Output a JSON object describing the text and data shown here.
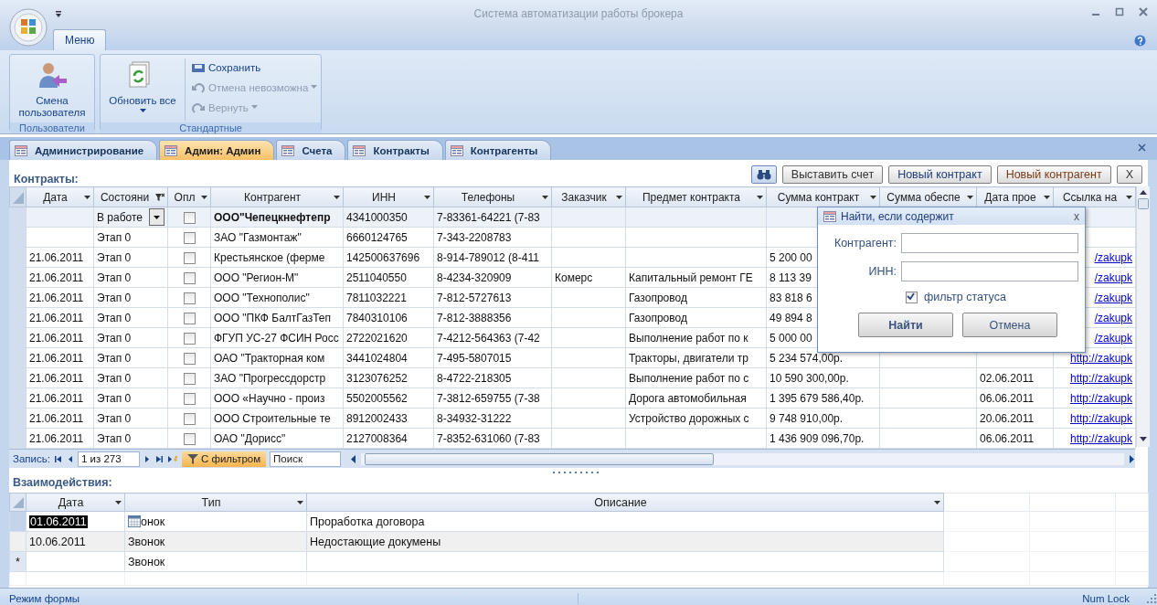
{
  "window": {
    "title": "Система автоматизации работы брокера"
  },
  "ribbon": {
    "tabs": [
      {
        "label": "Меню",
        "selected": true
      }
    ],
    "groups": [
      {
        "label": "Пользователи",
        "large_buttons": [
          {
            "label": "Смена пользователя",
            "dropdown": false
          }
        ]
      },
      {
        "label": "Стандартные",
        "large_buttons": [
          {
            "label": "Обновить все",
            "dropdown": true
          }
        ],
        "small_buttons": [
          {
            "label": "Сохранить",
            "disabled": false,
            "dropdown": false
          },
          {
            "label": "Отмена невозможна",
            "disabled": true,
            "dropdown": true
          },
          {
            "label": "Вернуть",
            "disabled": true,
            "dropdown": true
          }
        ]
      }
    ]
  },
  "doc_tabs": [
    {
      "label": "Администрирование",
      "selected": false
    },
    {
      "label": "Админ: Админ",
      "selected": true
    },
    {
      "label": "Счета",
      "selected": false
    },
    {
      "label": "Контракты",
      "selected": false
    },
    {
      "label": "Контрагенты",
      "selected": false
    }
  ],
  "form": {
    "title": "Контракты:",
    "buttons": [
      {
        "label": "Выставить счет",
        "kind": "normal"
      },
      {
        "label": "Новый контракт",
        "kind": "primary"
      },
      {
        "label": "Новый контрагент",
        "kind": "accent"
      },
      {
        "label": "X",
        "kind": "normal"
      }
    ]
  },
  "table": {
    "columns": [
      {
        "label": "Дата",
        "filtered": false
      },
      {
        "label": "Состояни",
        "filtered": true
      },
      {
        "label": "Опл",
        "filtered": false
      },
      {
        "label": "Контрагент",
        "filtered": false
      },
      {
        "label": "ИНН",
        "filtered": false
      },
      {
        "label": "Телефоны",
        "filtered": false
      },
      {
        "label": "Заказчик",
        "filtered": false
      },
      {
        "label": "Предмет контракта",
        "filtered": false
      },
      {
        "label": "Сумма контракт",
        "filtered": false
      },
      {
        "label": "Сумма обеспе",
        "filtered": false
      },
      {
        "label": "Дата прое",
        "filtered": false
      },
      {
        "label": "Ссылка на",
        "filtered": false
      }
    ],
    "rows": [
      {
        "selected": true,
        "date": "",
        "status": "В работе",
        "paid": false,
        "contractor": "ООО\"Чепецкнефтепр",
        "inn": "4341000350",
        "phones": "7-83361-64221  (7-83",
        "customer": "",
        "subject": "",
        "sum": "",
        "deposit": "",
        "deadline": "",
        "link": ""
      },
      {
        "selected": false,
        "date": "",
        "status": "Этап 0",
        "paid": false,
        "contractor": "ЗАО \"Газмонтаж\"",
        "inn": "6660124765",
        "phones": "7-343-2208783",
        "customer": "",
        "subject": "",
        "sum": "",
        "deposit": "",
        "deadline": "",
        "link": ""
      },
      {
        "selected": false,
        "date": "21.06.2011",
        "status": "Этап 0",
        "paid": false,
        "contractor": "Крестьянское (ферме",
        "inn": "142500637696",
        "phones": "8-914-789012  (8-411",
        "customer": "",
        "subject": "",
        "sum": "5 200 00",
        "deposit": "",
        "deadline": "",
        "link": "/zakupk"
      },
      {
        "selected": false,
        "date": "21.06.2011",
        "status": "Этап 0",
        "paid": false,
        "contractor": "ООО \"Регион-М\"",
        "inn": "2511040550",
        "phones": "8-4234-320909",
        "customer": "Комерс",
        "subject": "Капитальный ремонт ГЕ",
        "sum": "8 113 39",
        "deposit": "",
        "deadline": "",
        "link": "/zakupk"
      },
      {
        "selected": false,
        "date": "21.06.2011",
        "status": "Этап 0",
        "paid": false,
        "contractor": "ООО \"Технополис\"",
        "inn": "7811032221",
        "phones": "7-812-5727613",
        "customer": "",
        "subject": "Газопровод",
        "sum": "83 818 6",
        "deposit": "",
        "deadline": "",
        "link": "/zakupk"
      },
      {
        "selected": false,
        "date": "21.06.2011",
        "status": "Этап 0",
        "paid": false,
        "contractor": "ООО \"ПКФ БалтГазТеп",
        "inn": "7840310106",
        "phones": "7-812-3888356",
        "customer": "",
        "subject": "Газопровод",
        "sum": "49 894 8",
        "deposit": "",
        "deadline": "",
        "link": "/zakupk"
      },
      {
        "selected": false,
        "date": "21.06.2011",
        "status": "Этап 0",
        "paid": false,
        "contractor": "ФГУП УС-27 ФСИН Росс",
        "inn": "2722021620",
        "phones": "7-4212-564363  (7-42",
        "customer": "",
        "subject": "Выполнение работ по к",
        "sum": "5 000 00",
        "deposit": "",
        "deadline": "",
        "link": "/zakupk"
      },
      {
        "selected": false,
        "date": "21.06.2011",
        "status": "Этап 0",
        "paid": false,
        "contractor": "ОАО \"Тракторная ком",
        "inn": "3441024804",
        "phones": "7-495-5807015",
        "customer": "",
        "subject": "Тракторы, двигатели тр",
        "sum": "5 234 574,00р.",
        "deposit": "",
        "deadline": "",
        "link": "http://zakupk"
      },
      {
        "selected": false,
        "date": "21.06.2011",
        "status": "Этап 0",
        "paid": false,
        "contractor": "ЗАО \"Прогрессдорстр",
        "inn": "3123076252",
        "phones": "8-4722-218305",
        "customer": "",
        "subject": "Выполнение работ по с",
        "sum": "10 590 300,00р.",
        "deposit": "",
        "deadline": "02.06.2011",
        "link": "http://zakupk"
      },
      {
        "selected": false,
        "date": "21.06.2011",
        "status": "Этап 0",
        "paid": false,
        "contractor": "ООО  «Научно - произ",
        "inn": "5502005562",
        "phones": "7-3812-659755  (7-38",
        "customer": "",
        "subject": "Дорога автомобильная",
        "sum": "1 395 679 586,40р.",
        "deposit": "",
        "deadline": "06.06.2011",
        "link": "http://zakupk"
      },
      {
        "selected": false,
        "date": "21.06.2011",
        "status": "Этап 0",
        "paid": false,
        "contractor": "ООО Строительные те",
        "inn": "8912002433",
        "phones": "8-34932-31222",
        "customer": "",
        "subject": "Устройство дорожных с",
        "sum": "9 748 910,00р.",
        "deposit": "",
        "deadline": "20.06.2011",
        "link": "http://zakupk"
      },
      {
        "selected": false,
        "date": "21.06.2011",
        "status": "Этап 0",
        "paid": false,
        "contractor": "ОАО \"Дорисс\"",
        "inn": "2127008364",
        "phones": "7-8352-631060  (7-83",
        "customer": "",
        "subject": "",
        "sum": "1 436 909 096,70р.",
        "deposit": "",
        "deadline": "06.06.2011",
        "link": "http://zakupk"
      }
    ]
  },
  "navigation": {
    "label": "Запись:",
    "position": "1 из 273",
    "filter_label": "С фильтром",
    "filter_on": true,
    "search_placeholder": "Поиск"
  },
  "dialog": {
    "title": "Найти, если содержит",
    "close": "x",
    "fields": [
      {
        "label": "Контрагент:"
      },
      {
        "label": "ИНН:"
      }
    ],
    "filter_label": "фильтр статуса",
    "filter_checked": true,
    "buttons": [
      {
        "label": "Найти",
        "default": true
      },
      {
        "label": "Отмена",
        "default": false
      }
    ]
  },
  "subform": {
    "title": "Взаимодействия:",
    "columns": [
      "Дата",
      "Тип",
      "Описание"
    ],
    "rows": [
      {
        "selected": true,
        "marker": "",
        "date": "01.06.2011",
        "type": "онок",
        "description": "Проработка договора"
      },
      {
        "selected": false,
        "marker": "",
        "date": "10.06.2011",
        "type": "Звонок",
        "description": "Недостающие докумены"
      },
      {
        "selected": false,
        "marker": "*",
        "date": "",
        "type": "Звонок",
        "description": ""
      }
    ]
  },
  "status_bar": {
    "mode": "Режим формы",
    "indicator": "Num Lock"
  }
}
